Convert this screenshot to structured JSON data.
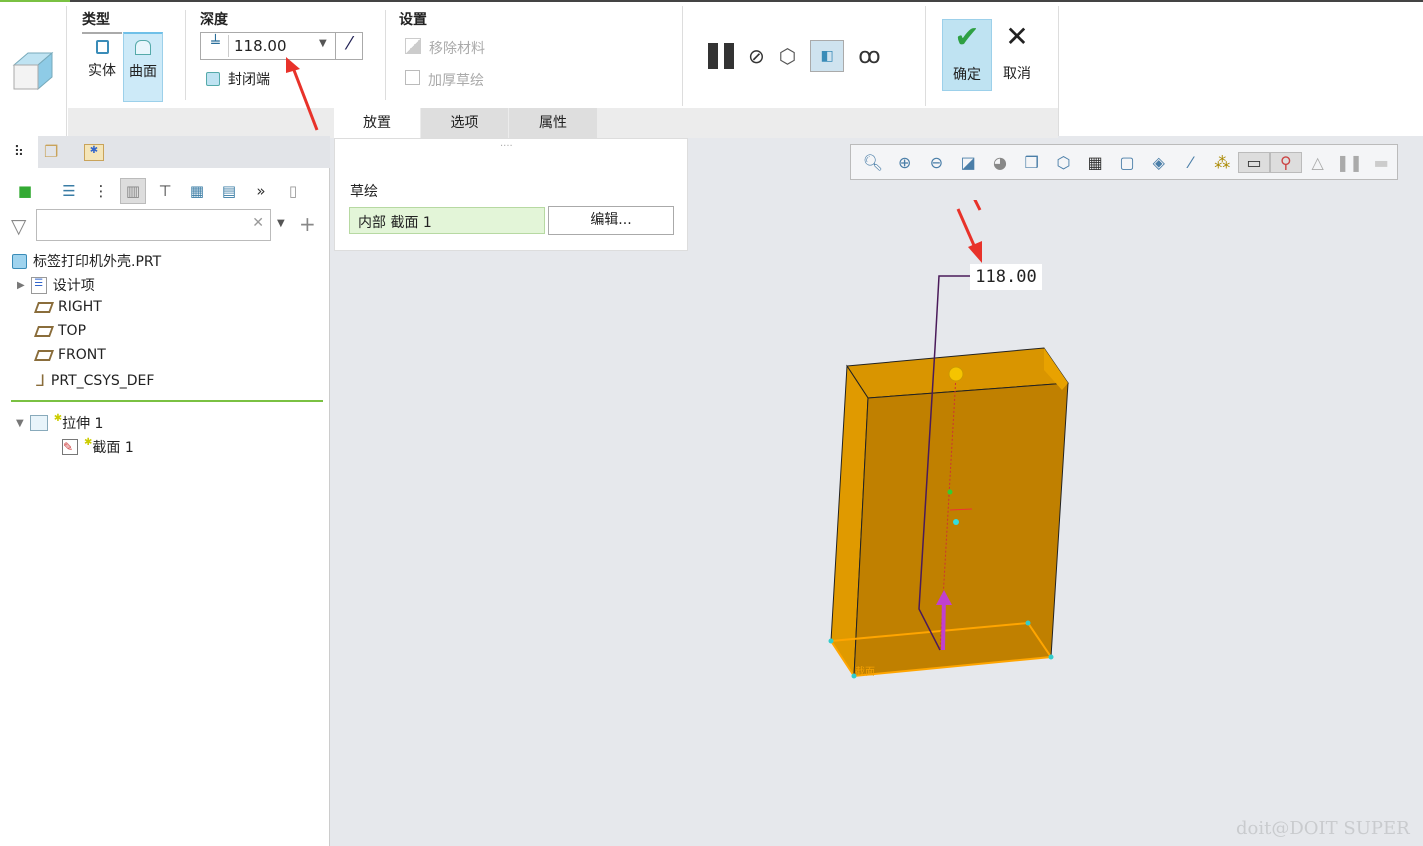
{
  "ribbon": {
    "type": {
      "title": "类型",
      "solid": "实体",
      "surface": "曲面",
      "selected": "曲面"
    },
    "depth": {
      "title": "深度",
      "value": "118.00",
      "capped_ends": "封闭端"
    },
    "settings": {
      "title": "设置",
      "remove_material": "移除材料",
      "thicken_sketch": "加厚草绘"
    },
    "actions": {
      "ok": "确定",
      "cancel": "取消"
    },
    "tabs": [
      {
        "label": "放置",
        "active": true
      },
      {
        "label": "选项"
      },
      {
        "label": "属性"
      }
    ]
  },
  "placement_panel": {
    "sketch_label": "草绘",
    "section_value": "内部 截面 1",
    "edit_button": "编辑..."
  },
  "model_tree": {
    "filter_placeholder": "",
    "root": "标签打印机外壳.PRT",
    "items": [
      {
        "label": "设计项",
        "icon": "design-items-icon"
      },
      {
        "label": "RIGHT",
        "icon": "datum-plane-icon"
      },
      {
        "label": "TOP",
        "icon": "datum-plane-icon"
      },
      {
        "label": "FRONT",
        "icon": "datum-plane-icon"
      },
      {
        "label": "PRT_CSYS_DEF",
        "icon": "csys-icon"
      }
    ],
    "feature": {
      "label": "拉伸 1",
      "child": "截面 1"
    }
  },
  "viewport": {
    "dimension": "118.00",
    "section_tag": "截面",
    "watermark": "doit@DOIT SUPER",
    "model_color": "#c98a00",
    "annotation_color": "#e8322a"
  }
}
